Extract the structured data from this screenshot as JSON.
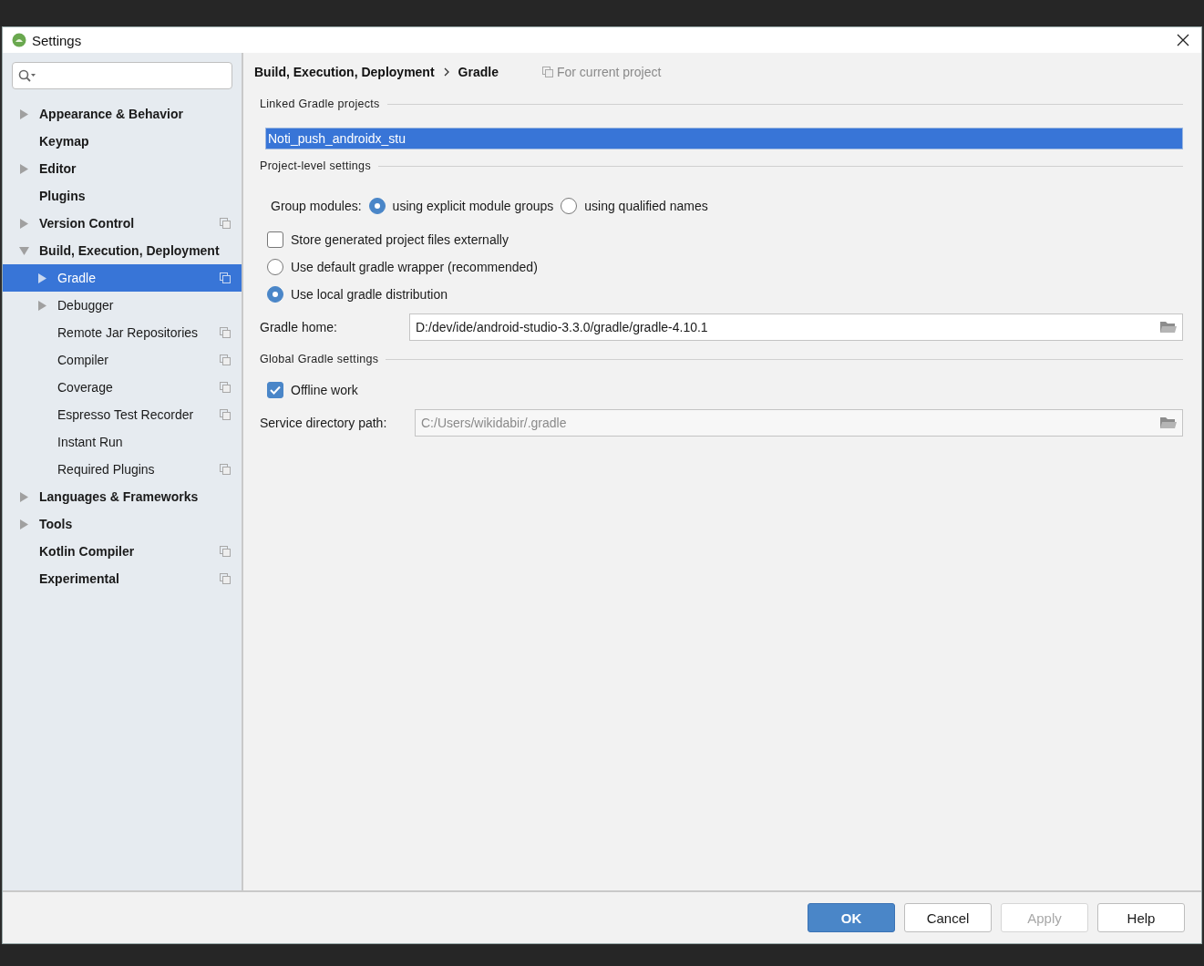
{
  "window": {
    "title": "Settings"
  },
  "sidebar": {
    "items": [
      {
        "label": "Appearance & Behavior",
        "expanded": false,
        "selected": false,
        "project_scope": false
      },
      {
        "label": "Keymap",
        "selected": false,
        "project_scope": false
      },
      {
        "label": "Editor",
        "expanded": false,
        "selected": false,
        "project_scope": false
      },
      {
        "label": "Plugins",
        "selected": false,
        "project_scope": false
      },
      {
        "label": "Version Control",
        "expanded": false,
        "selected": false,
        "project_scope": true
      },
      {
        "label": "Build, Execution, Deployment",
        "expanded": true,
        "selected": false,
        "project_scope": false,
        "children": [
          {
            "label": "Gradle",
            "expanded": false,
            "selected": true,
            "project_scope": true
          },
          {
            "label": "Debugger",
            "expanded": false,
            "selected": false,
            "project_scope": false
          },
          {
            "label": "Remote Jar Repositories",
            "selected": false,
            "project_scope": true
          },
          {
            "label": "Compiler",
            "selected": false,
            "project_scope": true
          },
          {
            "label": "Coverage",
            "selected": false,
            "project_scope": true
          },
          {
            "label": "Espresso Test Recorder",
            "selected": false,
            "project_scope": true
          },
          {
            "label": "Instant Run",
            "selected": false,
            "project_scope": false
          },
          {
            "label": "Required Plugins",
            "selected": false,
            "project_scope": true
          }
        ]
      },
      {
        "label": "Languages & Frameworks",
        "expanded": false,
        "selected": false,
        "project_scope": false
      },
      {
        "label": "Tools",
        "expanded": false,
        "selected": false,
        "project_scope": false
      },
      {
        "label": "Kotlin Compiler",
        "selected": false,
        "project_scope": true
      },
      {
        "label": "Experimental",
        "selected": false,
        "project_scope": true
      }
    ]
  },
  "breadcrumb": {
    "parts": [
      "Build, Execution, Deployment",
      "Gradle"
    ],
    "scope_note": "For current project"
  },
  "linked_projects": {
    "title": "Linked Gradle projects",
    "items": [
      {
        "label": "Noti_push_androidx_stu",
        "selected": true
      }
    ]
  },
  "project_settings": {
    "title": "Project-level settings",
    "group_modules": {
      "label": "Group modules:",
      "options": [
        {
          "label": "using explicit module groups",
          "selected": true
        },
        {
          "label": "using qualified names",
          "selected": false
        }
      ]
    },
    "store_externally": {
      "label": "Store generated project files externally",
      "checked": false
    },
    "distribution": [
      {
        "label": "Use default gradle wrapper (recommended)",
        "selected": false
      },
      {
        "label": "Use local gradle distribution",
        "selected": true
      }
    ],
    "gradle_home": {
      "label": "Gradle home:",
      "value": "D:/dev/ide/android-studio-3.3.0/gradle/gradle-4.10.1",
      "disabled": false
    }
  },
  "global_settings": {
    "title": "Global Gradle settings",
    "offline_work": {
      "label": "Offline work",
      "checked": true
    },
    "service_directory": {
      "label": "Service directory path:",
      "value": "C:/Users/wikidabir/.gradle",
      "disabled": true
    }
  },
  "buttons": [
    {
      "label": "OK",
      "kind": "primary",
      "disabled": false
    },
    {
      "label": "Cancel",
      "kind": "normal",
      "disabled": false
    },
    {
      "label": "Apply",
      "kind": "normal",
      "disabled": true
    },
    {
      "label": "Help",
      "kind": "normal",
      "disabled": false
    }
  ]
}
